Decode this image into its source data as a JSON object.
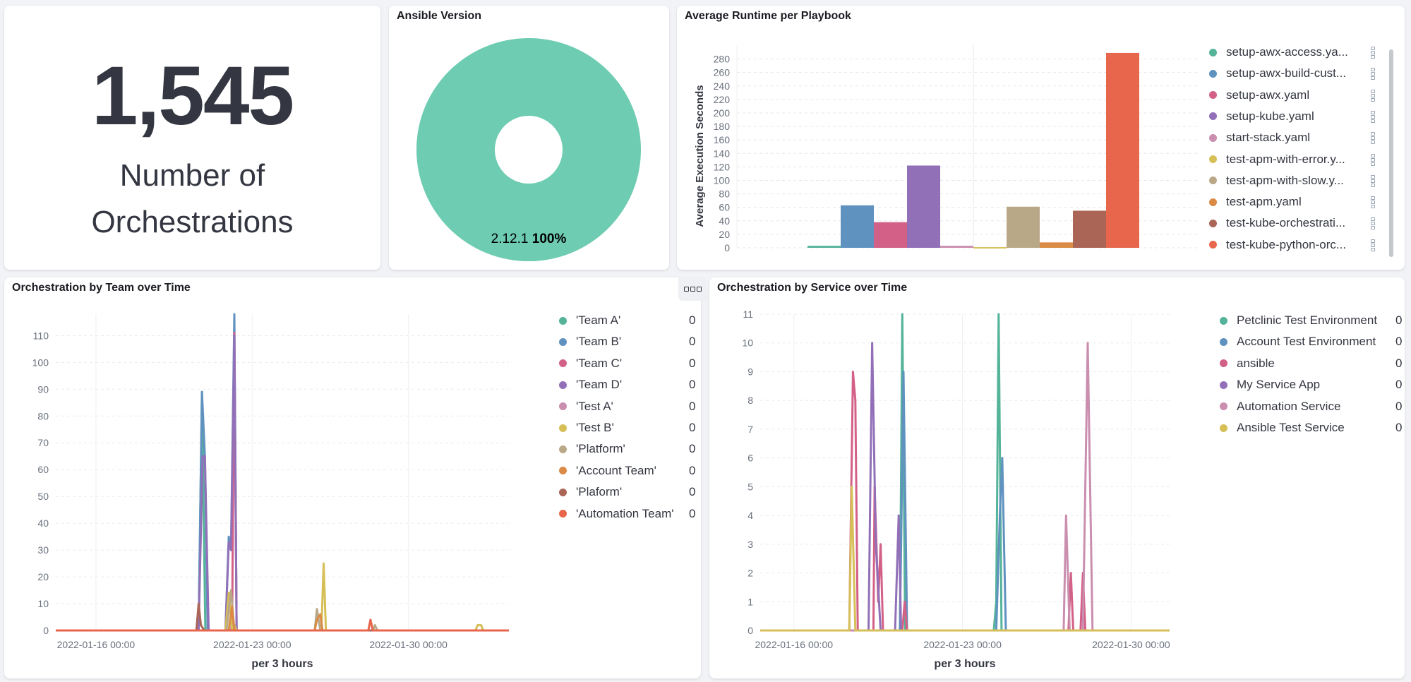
{
  "metric": {
    "value": "1,545",
    "label_line1": "Number of",
    "label_line2": "Orchestrations"
  },
  "pie_panel": {
    "title": "Ansible Version",
    "slice_label": "2.12.1",
    "slice_pct": "100%",
    "color": "#6dccb1"
  },
  "bar_panel": {
    "title": "Average Runtime per Playbook",
    "legend_options_icon": "kebab-icon"
  },
  "team_panel": {
    "title": "Orchestration by Team over Time",
    "options_icon": "panel-options-icon"
  },
  "service_panel": {
    "title": "Orchestration by Service over Time"
  },
  "chart_data": [
    {
      "type": "pie",
      "title": "Ansible Version",
      "donut": true,
      "slices": [
        {
          "label": "2.12.1",
          "value": 100,
          "color": "#6dccb1"
        }
      ],
      "data_label": "2.12.1 100%"
    },
    {
      "type": "bar",
      "title": "Average Runtime per Playbook",
      "xlabel": "",
      "ylabel": "Average Execution Seconds",
      "ylim": [
        0,
        290
      ],
      "yticks": [
        0,
        20,
        40,
        60,
        80,
        100,
        120,
        140,
        160,
        180,
        200,
        220,
        240,
        260,
        280
      ],
      "grid": true,
      "legend_position": "right",
      "categories": [
        "setup-awx-access.ya...",
        "setup-awx-build-cust...",
        "setup-awx.yaml",
        "setup-kube.yaml",
        "start-stack.yaml",
        "test-apm-with-error.y...",
        "test-apm-with-slow.y...",
        "test-apm.yaml",
        "test-kube-orchestrati...",
        "test-kube-python-orc..."
      ],
      "values": [
        3,
        63,
        38,
        122,
        3,
        1,
        61,
        8,
        55,
        289
      ],
      "colors": [
        "#54b399",
        "#6092c0",
        "#d36086",
        "#9170b8",
        "#ca8eae",
        "#d6bf57",
        "#b9a888",
        "#da8b45",
        "#aa6556",
        "#e7664c"
      ]
    },
    {
      "type": "line",
      "title": "Orchestration by Team over Time",
      "xlabel": "per 3 hours",
      "ylabel": "",
      "ylim": [
        0,
        118
      ],
      "yticks": [
        0,
        10,
        20,
        30,
        40,
        50,
        60,
        70,
        80,
        90,
        100,
        110
      ],
      "x_range_days": [
        -1.8,
        18.5
      ],
      "xticks": [
        {
          "day": 0,
          "label": "2022-01-16 00:00"
        },
        {
          "day": 7,
          "label": "2022-01-23 00:00"
        },
        {
          "day": 14,
          "label": "2022-01-30 00:00"
        }
      ],
      "grid": true,
      "legend_position": "right",
      "series": [
        {
          "name": "'Team A'",
          "value": "0",
          "color": "#54b399",
          "points": [
            [
              4.6,
              0
            ],
            [
              4.75,
              89
            ],
            [
              4.9,
              0
            ]
          ]
        },
        {
          "name": "'Team B'",
          "value": "0",
          "color": "#6092c0",
          "points": [
            [
              4.6,
              0
            ],
            [
              4.75,
              89
            ],
            [
              4.88,
              65
            ],
            [
              5.0,
              0
            ],
            [
              5.8,
              0
            ],
            [
              5.95,
              35
            ],
            [
              6.05,
              30
            ],
            [
              6.2,
              118
            ],
            [
              6.3,
              0
            ]
          ]
        },
        {
          "name": "'Team C'",
          "value": "0",
          "color": "#d36086",
          "points": [
            [
              6.1,
              0
            ],
            [
              6.2,
              111
            ],
            [
              6.3,
              0
            ]
          ]
        },
        {
          "name": "'Team D'",
          "value": "0",
          "color": "#9170b8",
          "points": [
            [
              4.6,
              0
            ],
            [
              4.78,
              65
            ],
            [
              4.88,
              65
            ],
            [
              5.05,
              0
            ],
            [
              5.8,
              0
            ],
            [
              5.95,
              33
            ],
            [
              6.05,
              30
            ],
            [
              6.2,
              110
            ],
            [
              6.3,
              0
            ]
          ]
        },
        {
          "name": "'Test A'",
          "value": "0",
          "color": "#ca8eae",
          "points": [
            [
              6.0,
              0
            ],
            [
              6.1,
              2
            ],
            [
              6.2,
              0
            ]
          ]
        },
        {
          "name": "'Test B'",
          "value": "0",
          "color": "#d6bf57",
          "points": [
            [
              5.8,
              0
            ],
            [
              5.95,
              14
            ],
            [
              6.1,
              0
            ],
            [
              6.2,
              2
            ],
            [
              6.3,
              0
            ],
            [
              10.1,
              0
            ],
            [
              10.2,
              25
            ],
            [
              10.3,
              0
            ],
            [
              17.0,
              0
            ],
            [
              17.1,
              2
            ],
            [
              17.25,
              2
            ],
            [
              17.35,
              0
            ]
          ]
        },
        {
          "name": "'Platform'",
          "value": "0",
          "color": "#b9a888",
          "points": [
            [
              5.85,
              0
            ],
            [
              6.05,
              15
            ],
            [
              6.2,
              0
            ],
            [
              9.8,
              0
            ],
            [
              9.9,
              8
            ],
            [
              10.05,
              0
            ],
            [
              12.4,
              0
            ],
            [
              12.5,
              2
            ],
            [
              12.6,
              0
            ]
          ]
        },
        {
          "name": "'Account Team'",
          "value": "0",
          "color": "#da8b45",
          "points": [
            [
              5.95,
              0
            ],
            [
              6.1,
              9
            ],
            [
              6.2,
              0
            ],
            [
              9.8,
              0
            ],
            [
              9.9,
              4
            ],
            [
              10.05,
              6
            ],
            [
              10.15,
              0
            ]
          ]
        },
        {
          "name": "'Plaform'",
          "value": "0",
          "color": "#aa6556",
          "points": [
            [
              4.5,
              0
            ],
            [
              4.6,
              10
            ],
            [
              4.7,
              2
            ],
            [
              4.85,
              0
            ]
          ]
        },
        {
          "name": "'Automation Team'",
          "value": "0",
          "color": "#e7664c",
          "points": [
            [
              12.2,
              0
            ],
            [
              12.3,
              4
            ],
            [
              12.4,
              0
            ]
          ]
        }
      ]
    },
    {
      "type": "line",
      "title": "Orchestration by Service over Time",
      "xlabel": "per 3 hours",
      "ylabel": "",
      "ylim": [
        0,
        11
      ],
      "yticks": [
        0,
        1,
        2,
        3,
        4,
        5,
        6,
        7,
        8,
        9,
        10,
        11
      ],
      "x_range_days": [
        -1.4,
        15.6
      ],
      "xticks": [
        {
          "day": 0,
          "label": "2022-01-16 00:00"
        },
        {
          "day": 7,
          "label": "2022-01-23 00:00"
        },
        {
          "day": 14,
          "label": "2022-01-30 00:00"
        }
      ],
      "grid": true,
      "legend_position": "right",
      "series": [
        {
          "name": "Petclinic Test Environment",
          "value": "0",
          "color": "#54b399",
          "points": [
            [
              4.4,
              0
            ],
            [
              4.5,
              11
            ],
            [
              4.62,
              0
            ],
            [
              8.3,
              0
            ],
            [
              8.4,
              1
            ],
            [
              8.5,
              11
            ],
            [
              8.62,
              0
            ]
          ]
        },
        {
          "name": "Account Test Environment",
          "value": "0",
          "color": "#6092c0",
          "points": [
            [
              4.4,
              0
            ],
            [
              4.55,
              9
            ],
            [
              4.7,
              0
            ],
            [
              8.4,
              0
            ],
            [
              8.55,
              4
            ],
            [
              8.65,
              6
            ],
            [
              8.8,
              0
            ]
          ]
        },
        {
          "name": "ansible",
          "value": "0",
          "color": "#d36086",
          "points": [
            [
              2.3,
              0
            ],
            [
              2.45,
              9
            ],
            [
              2.55,
              8
            ],
            [
              2.65,
              0
            ],
            [
              3.3,
              0
            ],
            [
              3.35,
              5
            ],
            [
              3.5,
              1
            ],
            [
              3.6,
              3
            ],
            [
              3.7,
              0
            ],
            [
              4.5,
              0
            ],
            [
              4.6,
              1
            ],
            [
              4.7,
              0
            ],
            [
              11.4,
              0
            ],
            [
              11.5,
              2
            ],
            [
              11.6,
              0
            ],
            [
              11.9,
              0
            ],
            [
              12.0,
              2
            ],
            [
              12.1,
              0
            ]
          ]
        },
        {
          "name": "My Service App",
          "value": "0",
          "color": "#9170b8",
          "points": [
            [
              3.1,
              0
            ],
            [
              3.25,
              10
            ],
            [
              3.4,
              3
            ],
            [
              3.6,
              0
            ],
            [
              4.2,
              0
            ],
            [
              4.35,
              4
            ],
            [
              4.45,
              0
            ]
          ]
        },
        {
          "name": "Automation Service",
          "value": "0",
          "color": "#ca8eae",
          "points": [
            [
              11.2,
              0
            ],
            [
              11.3,
              4
            ],
            [
              11.45,
              0
            ],
            [
              12.0,
              0
            ],
            [
              12.2,
              10
            ],
            [
              12.4,
              0
            ]
          ]
        },
        {
          "name": "Ansible Test Service",
          "value": "0",
          "color": "#d6bf57",
          "points": [
            [
              2.3,
              0
            ],
            [
              2.4,
              5
            ],
            [
              2.55,
              0
            ]
          ]
        }
      ]
    }
  ]
}
